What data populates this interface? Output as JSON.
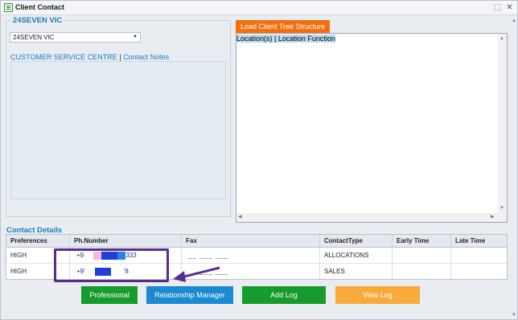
{
  "window": {
    "title": "Client Contact",
    "pin_glyph": "⬚",
    "close_glyph": "✕"
  },
  "client": {
    "group_title": "24SEVEN VIC",
    "selected": "24SEVEN VIC",
    "link_primary": "CUSTOMER SERVICE CENTRE",
    "link_separator": "|",
    "link_secondary": "Contact Notes"
  },
  "tree": {
    "button_label": "Load Client Tree Structure",
    "header": "Location(s) | Location Function"
  },
  "contacts": {
    "title": "Contact Details",
    "columns": [
      "Preferences",
      "Ph.Number",
      "Fax",
      "ContactType",
      "Early Time",
      "Late Time"
    ],
    "rows": [
      {
        "preference": "HIGH",
        "phone_prefix": "+9",
        "phone_suffix": "333",
        "fax": "__ ___ ___",
        "contact_type": "ALLOCATIONS",
        "early": "",
        "late": ""
      },
      {
        "preference": "HIGH",
        "phone_prefix": "+9'",
        "phone_suffix": "'8",
        "fax": "__ ___ ___",
        "contact_type": "SALES",
        "early": "",
        "late": ""
      }
    ]
  },
  "actions": {
    "professional": "Professional",
    "relationship_manager": "Relationship Manager",
    "add_log": "Add Log",
    "view_log": "View Log"
  },
  "colors": {
    "accent_blue": "#1d7ab8",
    "orange": "#f36f0d",
    "green": "#169b2d",
    "light_orange": "#f8ab3a",
    "annotation_purple": "#5a2d8c"
  }
}
